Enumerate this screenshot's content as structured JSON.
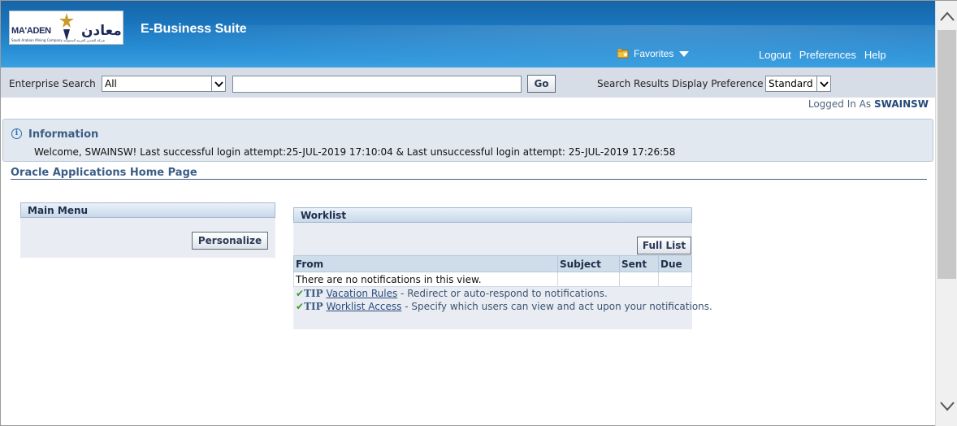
{
  "header": {
    "logo_latin": "MA'ADEN",
    "logo_arabic": "معادن",
    "logo_tagline": "Saudi Arabian Mining Company شركة التعدين العربية السعودية",
    "app_title": "E-Business Suite",
    "favorites": "Favorites",
    "links": [
      "Logout",
      "Preferences",
      "Help"
    ]
  },
  "search": {
    "label": "Enterprise Search",
    "scope": "All",
    "query": "",
    "go": "Go",
    "pref_label": "Search Results Display Preference",
    "pref_value": "Standard"
  },
  "session": {
    "logged_in_prefix": "Logged In As",
    "user": "SWAINSW"
  },
  "info": {
    "title": "Information",
    "message": "Welcome, SWAINSW! Last successful login attempt:25-JUL-2019 17:10:04 & Last unsuccessful login attempt: 25-JUL-2019 17:26:58"
  },
  "page_title": "Oracle Applications Home Page",
  "main_menu": {
    "title": "Main Menu",
    "personalize": "Personalize"
  },
  "worklist": {
    "title": "Worklist",
    "full_list": "Full List",
    "columns": [
      "From",
      "Subject",
      "Sent",
      "Due"
    ],
    "empty_text": "There are no notifications in this view.",
    "tips": [
      {
        "label": "TIP",
        "link": "Vacation Rules",
        "text": " - Redirect or auto-respond to notifications."
      },
      {
        "label": "TIP",
        "link": "Worklist Access",
        "text": " - Specify which users can view and act upon your notifications."
      }
    ]
  },
  "colors": {
    "header_blue": "#1b78c0",
    "accent_text": "#3b5d85",
    "panel_bg": "#e9edf3"
  }
}
